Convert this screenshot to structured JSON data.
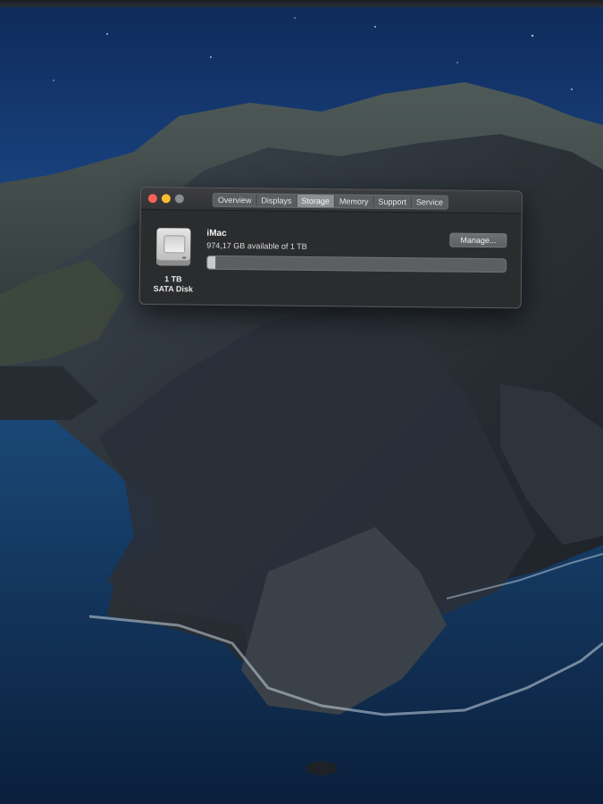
{
  "window": {
    "traffic_lights": [
      "close",
      "minimize",
      "zoom"
    ],
    "tabs": [
      {
        "label": "Overview",
        "active": false
      },
      {
        "label": "Displays",
        "active": false
      },
      {
        "label": "Storage",
        "active": true
      },
      {
        "label": "Memory",
        "active": false
      },
      {
        "label": "Support",
        "active": false
      },
      {
        "label": "Service",
        "active": false
      }
    ]
  },
  "storage": {
    "disk_icon": "hard-drive-icon",
    "disk_size": "1 TB",
    "disk_type": "SATA Disk",
    "volume_name": "iMac",
    "available_text": "974,17 GB available of 1 TB",
    "manage_label": "Manage...",
    "used_fraction": 0.026
  },
  "colors": {
    "close": "#fc5f57",
    "minimize": "#fdbc2e",
    "zoom_inactive": "#8a8b8d"
  }
}
